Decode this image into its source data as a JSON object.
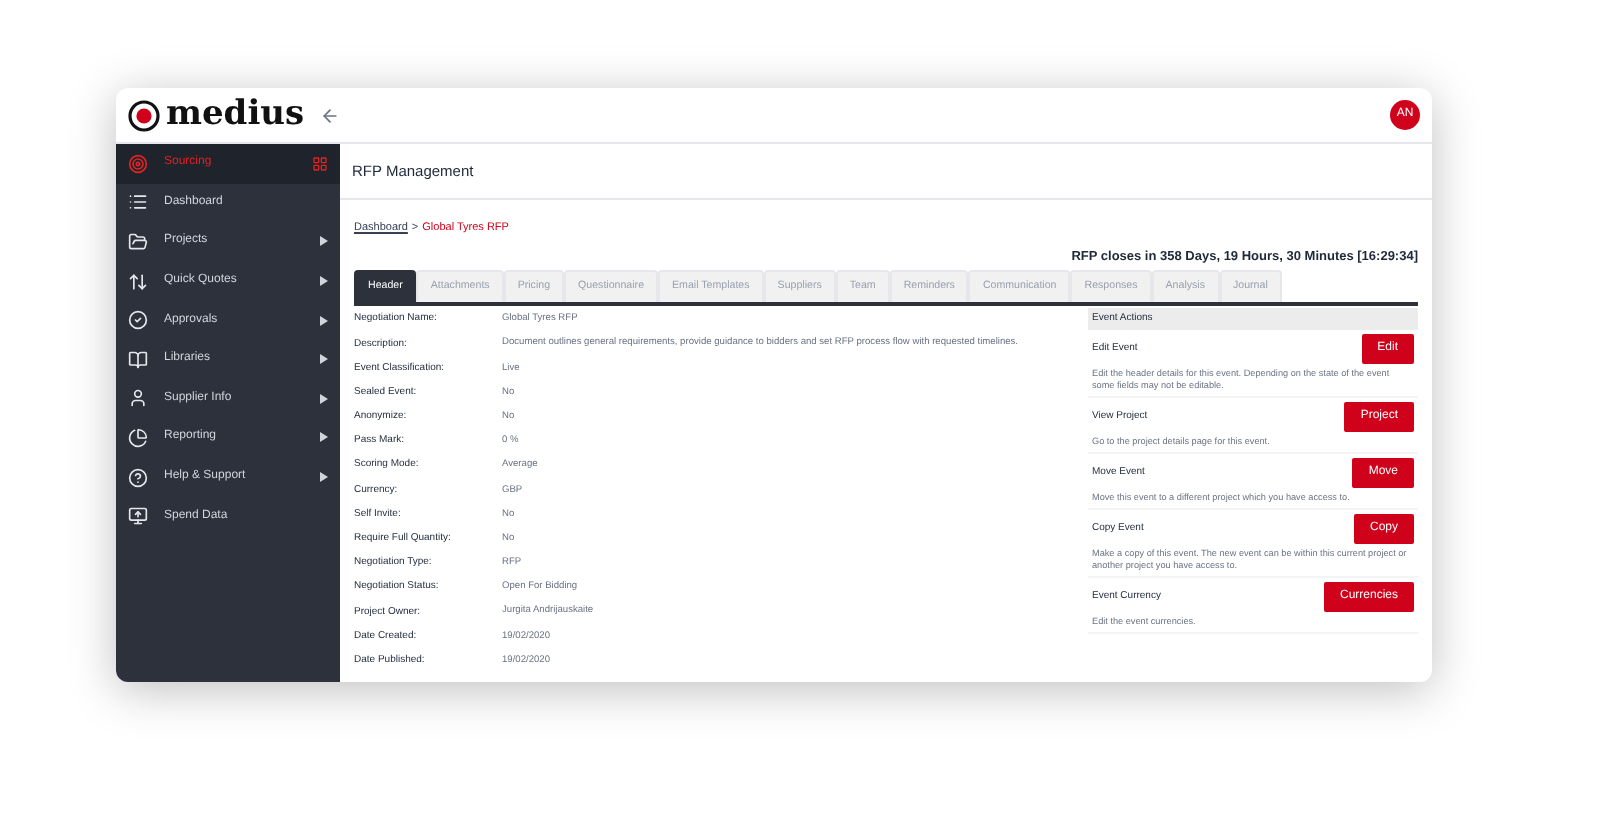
{
  "brand": "medius",
  "avatar": "AN",
  "sidebar": {
    "items": [
      {
        "label": "Sourcing",
        "selected": true,
        "has_submenu": false
      },
      {
        "label": "Dashboard",
        "selected": false,
        "has_submenu": false
      },
      {
        "label": "Projects",
        "selected": false,
        "has_submenu": true
      },
      {
        "label": "Quick Quotes",
        "selected": false,
        "has_submenu": true
      },
      {
        "label": "Approvals",
        "selected": false,
        "has_submenu": true
      },
      {
        "label": "Libraries",
        "selected": false,
        "has_submenu": true
      },
      {
        "label": "Supplier Info",
        "selected": false,
        "has_submenu": true
      },
      {
        "label": "Reporting",
        "selected": false,
        "has_submenu": true
      },
      {
        "label": "Help & Support",
        "selected": false,
        "has_submenu": true
      },
      {
        "label": "Spend Data",
        "selected": false,
        "has_submenu": false
      }
    ]
  },
  "page_title": "RFP Management",
  "breadcrumb": {
    "link": "Dashboard",
    "separator": ">",
    "current": "Global Tyres RFP"
  },
  "countdown": "RFP closes in 358 Days, 19 Hours, 30 Minutes [16:29:34]",
  "tabs": [
    {
      "label": "Header",
      "selected": true
    },
    {
      "label": "Attachments",
      "selected": false
    },
    {
      "label": "Pricing",
      "selected": false
    },
    {
      "label": "Questionnaire",
      "selected": false
    },
    {
      "label": "Email Templates",
      "selected": false
    },
    {
      "label": "Suppliers",
      "selected": false
    },
    {
      "label": "Team",
      "selected": false
    },
    {
      "label": "Reminders",
      "selected": false
    },
    {
      "label": "Communication",
      "selected": false
    },
    {
      "label": "Responses",
      "selected": false
    },
    {
      "label": "Analysis",
      "selected": false
    },
    {
      "label": "Journal",
      "selected": false
    }
  ],
  "details": [
    {
      "label": "Negotiation Name:",
      "value": "Global Tyres RFP"
    },
    {
      "label": "Description:",
      "value": "Document outlines general requirements, provide guidance to bidders and set RFP process flow with requested timelines."
    },
    {
      "label": "Event Classification:",
      "value": "Live"
    },
    {
      "label": "Sealed Event:",
      "value": "No"
    },
    {
      "label": "Anonymize:",
      "value": "No"
    },
    {
      "label": "Pass Mark:",
      "value": "0 %"
    },
    {
      "label": "Scoring Mode:",
      "value": "Average"
    },
    {
      "label": "Currency:",
      "value": "GBP"
    },
    {
      "label": "Self Invite:",
      "value": "No"
    },
    {
      "label": "Require Full Quantity:",
      "value": "No"
    },
    {
      "label": "Negotiation Type:",
      "value": "RFP"
    },
    {
      "label": "Negotiation Status:",
      "value": "Open For Bidding"
    },
    {
      "label": "Project Owner:",
      "value": "Jurgita Andrijauskaite"
    },
    {
      "label": "Date Created:",
      "value": "19/02/2020"
    },
    {
      "label": "Date Published:",
      "value": "19/02/2020"
    }
  ],
  "event_actions": {
    "title": "Event Actions",
    "actions": [
      {
        "name": "Edit Event",
        "button": "Edit",
        "description": "Edit the header details for this event. Depending on the state of the event some fields may not be editable."
      },
      {
        "name": "View Project",
        "button": "Project",
        "description": "Go to the project details page for this event."
      },
      {
        "name": "Move Event",
        "button": "Move",
        "description": "Move this event to a different project which you have access to."
      },
      {
        "name": "Copy Event",
        "button": "Copy",
        "description": "Make a copy of this event. The new event can be within this current project or another project you have access to."
      },
      {
        "name": "Event Currency",
        "button": "Currencies",
        "description": "Edit the event currencies."
      }
    ]
  }
}
